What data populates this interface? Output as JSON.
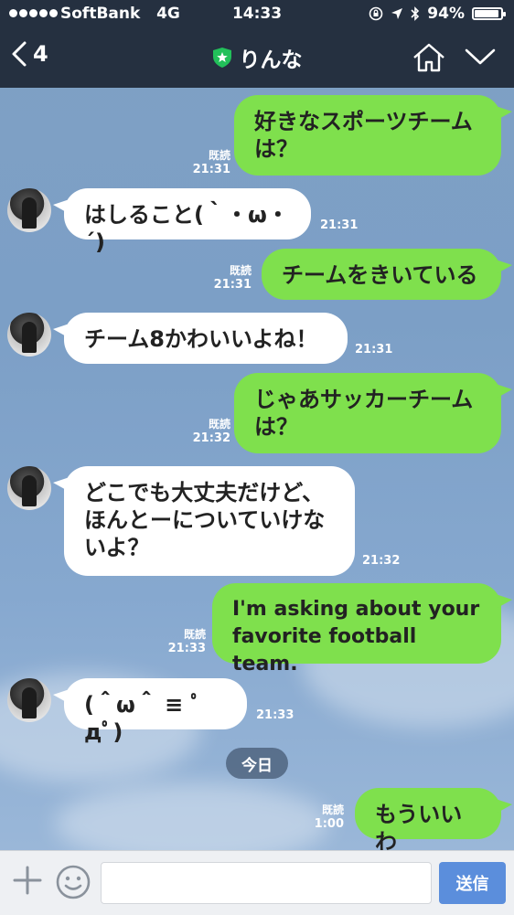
{
  "status_bar": {
    "carrier": "SoftBank",
    "network": "4G",
    "time": "14:33",
    "battery": "94%",
    "battery_level": 0.94
  },
  "header": {
    "back_count": "4",
    "title": "りんな",
    "icons": [
      "back-chevron-icon",
      "official-shield-icon",
      "home-icon",
      "chevron-down-icon"
    ]
  },
  "messages": [
    {
      "from": "me",
      "text": "好きなスポーツチーム\nは？",
      "read": "既読",
      "time": "21:31"
    },
    {
      "from": "them",
      "text": "はしること(｀・ω・´)",
      "time": "21:31"
    },
    {
      "from": "me",
      "text": "チームをきいている",
      "read": "既読",
      "time": "21:31"
    },
    {
      "from": "them",
      "text": "チーム8かわいいよね！",
      "time": "21:31"
    },
    {
      "from": "me",
      "text": "じゃあサッカーチーム\nは？",
      "read": "既読",
      "time": "21:32"
    },
    {
      "from": "them",
      "text": "どこでも大丈夫だけど、\nほんとーについていけな\nいよ？",
      "time": "21:32"
    },
    {
      "from": "me",
      "text": "I'm asking about your\nfavorite football team.",
      "read": "既読",
      "time": "21:33"
    },
    {
      "from": "them",
      "text": "(＾ω＾ ≡ ﾟдﾟ)",
      "time": "21:33"
    },
    {
      "from": "me",
      "text": "もういいわ",
      "read": "既読",
      "time": "1:00"
    }
  ],
  "date_divider": "今日",
  "input_bar": {
    "placeholder": "",
    "send_label": "送信"
  },
  "colors": {
    "header_bg": "#253040",
    "my_bubble": "#7fe04d",
    "their_bubble": "#ffffff",
    "send_button": "#5b8edc"
  }
}
